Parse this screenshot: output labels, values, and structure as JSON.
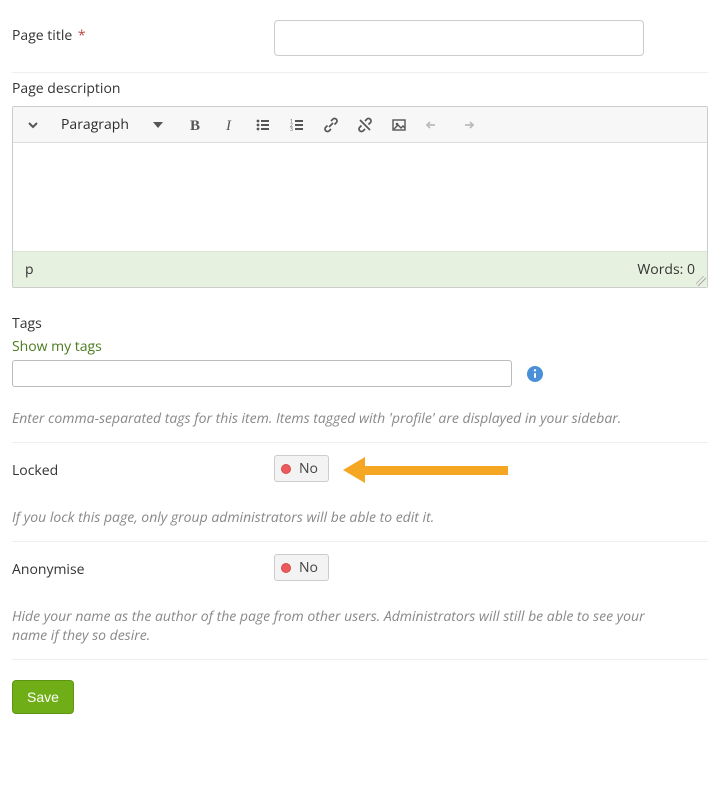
{
  "pageTitle": {
    "label": "Page title",
    "required_marker": "*",
    "value": ""
  },
  "pageDescription": {
    "label": "Page description",
    "format_selected": "Paragraph",
    "content": "",
    "status_path": "p",
    "word_count_label": "Words: 0"
  },
  "tags": {
    "label": "Tags",
    "show_my_tags": "Show my tags",
    "value": "",
    "help": "Enter comma-separated tags for this item. Items tagged with 'profile' are displayed in your sidebar."
  },
  "locked": {
    "label": "Locked",
    "toggle_value": "No",
    "help": "If you lock this page, only group administrators will be able to edit it."
  },
  "anonymise": {
    "label": "Anonymise",
    "toggle_value": "No",
    "help": "Hide your name as the author of the page from other users. Administrators will still be able to see your name if they so desire."
  },
  "save_button": "Save"
}
